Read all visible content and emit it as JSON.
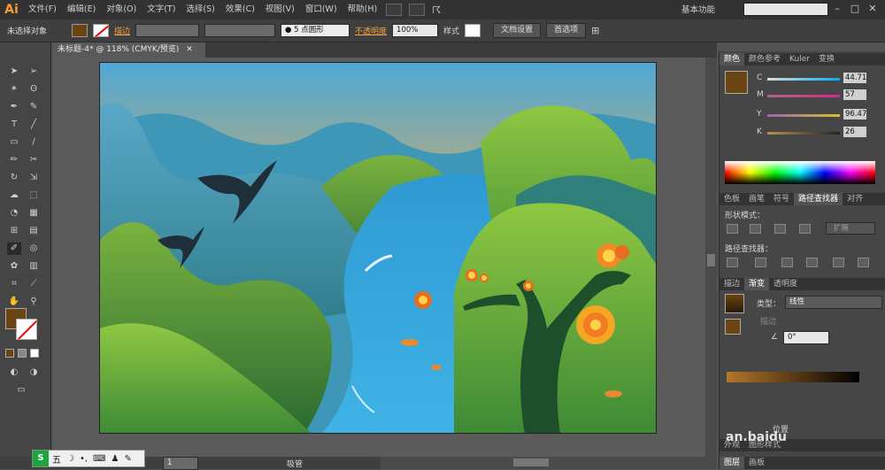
{
  "app": {
    "logo": "Ai"
  },
  "menu": [
    "文件(F)",
    "编辑(E)",
    "对象(O)",
    "文字(T)",
    "选择(S)",
    "效果(C)",
    "视图(V)",
    "窗口(W)",
    "帮助(H)"
  ],
  "workspace": "基本功能",
  "control": {
    "selection": "未选择对象",
    "stroke_label": "描边",
    "brush": "● 5 点圆形",
    "opacity_label": "不透明度",
    "opacity_value": "100%",
    "style_label": "样式",
    "doc_setup": "文档设置",
    "prefs": "首选项"
  },
  "document_tab": "未标题-4* @ 118% (CMYK/预览)",
  "color_panel": {
    "tabs": [
      "颜色",
      "颜色参考",
      "Kuler",
      "变换"
    ],
    "channels": [
      {
        "name": "C",
        "value": "44.71"
      },
      {
        "name": "M",
        "value": "57"
      },
      {
        "name": "Y",
        "value": "96.47"
      },
      {
        "name": "K",
        "value": "26"
      }
    ],
    "fill_color": "#6a4413"
  },
  "pathfinder": {
    "tabs": [
      "色板",
      "画笔",
      "符号",
      "路径查找器",
      "对齐"
    ],
    "shape_modes": "形状模式：",
    "expand": "扩展",
    "pathfinders": "路径查找器："
  },
  "gradient": {
    "tabs": [
      "描边",
      "渐变",
      "透明度"
    ],
    "type_label": "类型：",
    "type_value": "线性",
    "stroke_label": "描边",
    "angle": "0°",
    "location_label": "位置"
  },
  "bottom_tabs": [
    "外观",
    "图形样式"
  ],
  "layers_tabs": [
    "图层",
    "画板"
  ],
  "status": {
    "page": "1",
    "tool": "吸管"
  },
  "ime": {
    "label": "五"
  },
  "watermark": "an.baidu"
}
